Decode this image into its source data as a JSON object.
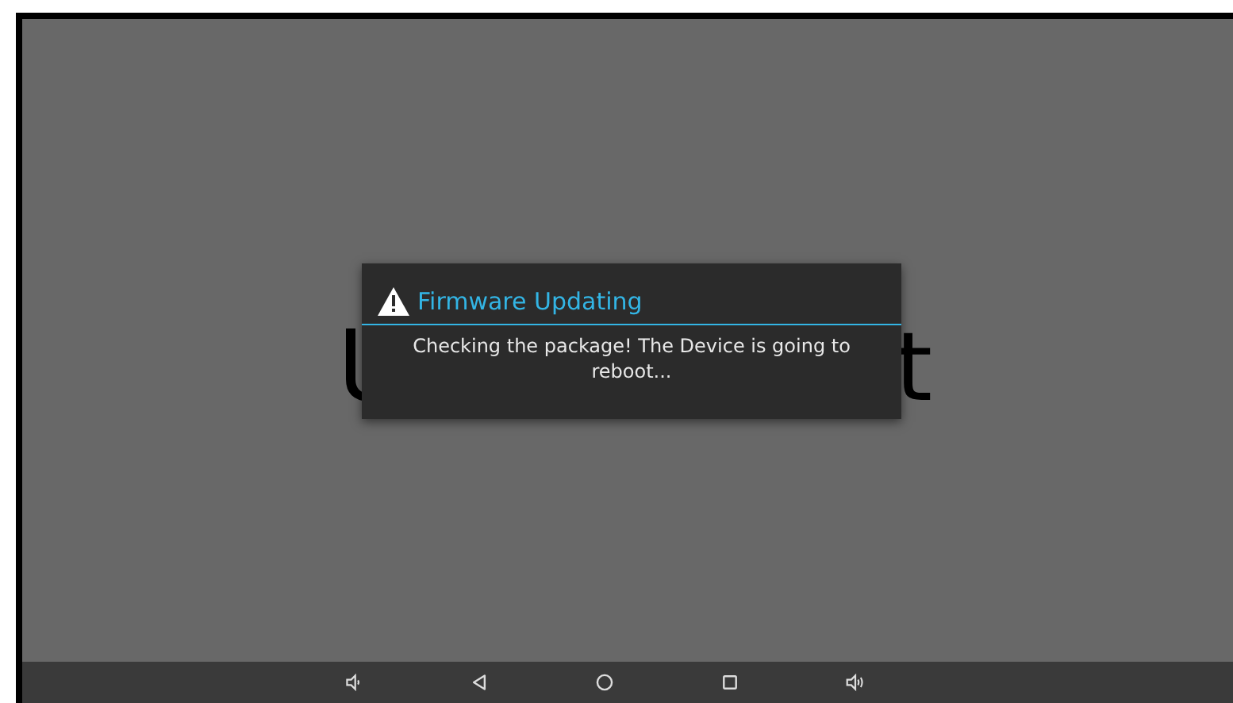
{
  "background_text": [
    "t"
  ],
  "dialog": {
    "title": "Firmware Updating",
    "message": "Checking the package! The Device is going to reboot..."
  },
  "nav_bar": {
    "buttons": [
      {
        "kind": "volume-down"
      },
      {
        "kind": "back"
      },
      {
        "kind": "home"
      },
      {
        "kind": "recents"
      },
      {
        "kind": "volume-up"
      }
    ]
  }
}
